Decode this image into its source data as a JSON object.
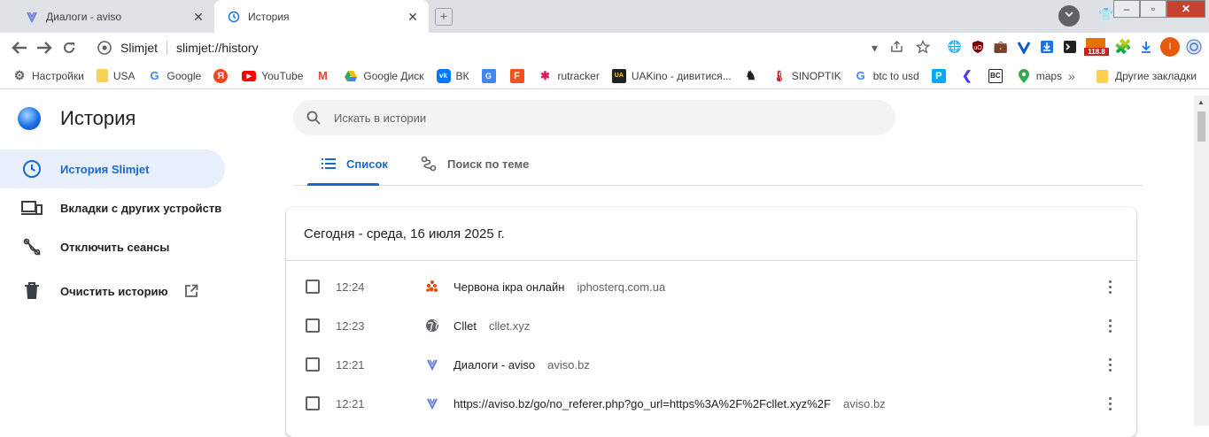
{
  "browser": {
    "tabs": [
      {
        "title": "Диалоги - aviso",
        "active": false
      },
      {
        "title": "История",
        "active": true
      }
    ],
    "profile_initial": "I",
    "window_controls": {
      "minimize": "–",
      "maximize": "▫",
      "close": "✕"
    },
    "address": {
      "site_name": "Slimjet",
      "url": "slimjet://history"
    },
    "extension_badge": "118.8",
    "bookmarks": [
      {
        "label": "Настройки",
        "icon": "gear-icon"
      },
      {
        "label": "USA",
        "icon": "folder-icon"
      },
      {
        "label": "Google",
        "icon": "google-icon"
      },
      {
        "label": "",
        "icon": "yandex-icon"
      },
      {
        "label": "YouTube",
        "icon": "youtube-icon"
      },
      {
        "label": "",
        "icon": "gmail-icon"
      },
      {
        "label": "Google Диск",
        "icon": "drive-icon"
      },
      {
        "label": "ВК",
        "icon": "vk-icon"
      },
      {
        "label": "",
        "icon": "translate-icon"
      },
      {
        "label": "",
        "icon": "f-icon"
      },
      {
        "label": "rutracker",
        "icon": "rutracker-icon"
      },
      {
        "label": "UAKino - дивитися...",
        "icon": "uakino-icon"
      },
      {
        "label": "",
        "icon": "chess-icon"
      },
      {
        "label": "SINOPTIK",
        "icon": "thermometer-icon"
      },
      {
        "label": "btc to usd",
        "icon": "google-icon"
      },
      {
        "label": "",
        "icon": "p-icon"
      },
      {
        "label": "",
        "icon": "arrow-icon"
      },
      {
        "label": "",
        "icon": "bc-icon"
      },
      {
        "label": "maps",
        "icon": "maps-icon"
      }
    ],
    "bookmarks_more": "»",
    "other_bookmarks": "Другие закладки"
  },
  "colors": {
    "accent": "#1967d2",
    "accent_bg": "#e8f0fe",
    "frame": "#dee1e6"
  },
  "history": {
    "title": "История",
    "search_placeholder": "Искать в истории",
    "sidebar": [
      {
        "label": "История Slimjet",
        "icon": "clock-icon",
        "active": true
      },
      {
        "label": "Вкладки с других устройств",
        "icon": "devices-icon"
      },
      {
        "label": "Отключить сеансы",
        "icon": "journeys-off-icon"
      },
      {
        "label": "Очистить историю",
        "icon": "trash-icon"
      }
    ],
    "tabs": [
      {
        "label": "Список",
        "icon": "list-icon",
        "active": true
      },
      {
        "label": "Поиск по теме",
        "icon": "journeys-icon"
      }
    ],
    "day_header": "Сегодня - среда, 16 июля 2025 г.",
    "entries": [
      {
        "time": "12:24",
        "title": "Червона ікра онлайн",
        "domain": "iphosterq.com.ua",
        "icon": "fire-dots-icon"
      },
      {
        "time": "12:23",
        "title": "Cllet",
        "domain": "cllet.xyz",
        "icon": "globe-icon"
      },
      {
        "time": "12:21",
        "title": "Диалоги - aviso",
        "domain": "aviso.bz",
        "icon": "aviso-icon"
      },
      {
        "time": "12:21",
        "title": "https://aviso.bz/go/no_referer.php?go_url=https%3A%2F%2Fcllet.xyz%2F",
        "domain": "aviso.bz",
        "icon": "aviso-icon"
      }
    ]
  }
}
